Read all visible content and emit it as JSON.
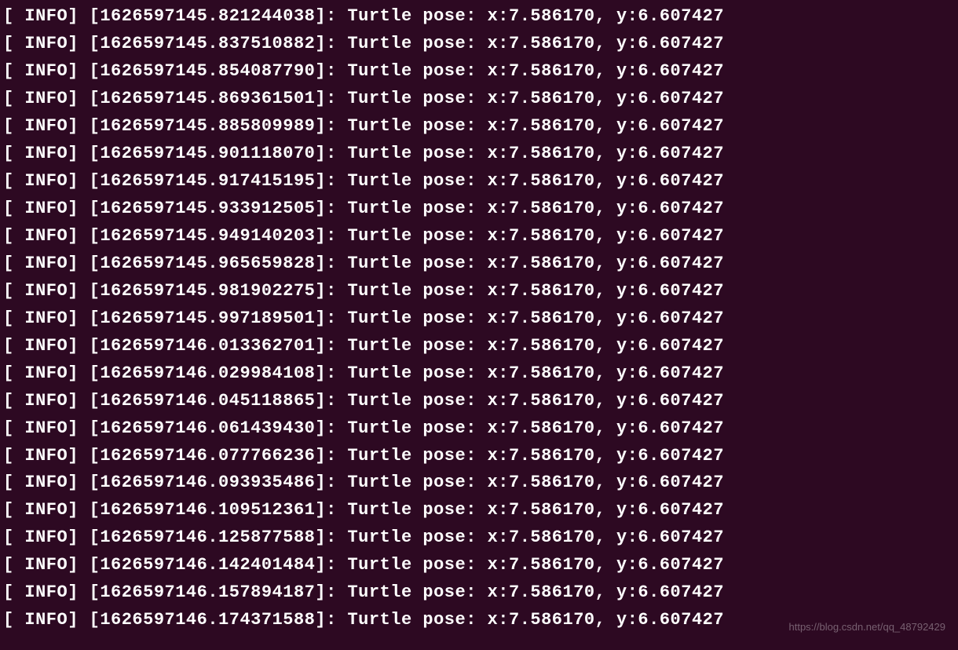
{
  "log": {
    "level": "INFO",
    "message_prefix": "Turtle pose:",
    "x_value": "7.586170",
    "y_value": "6.607427",
    "entries": [
      {
        "timestamp": "1626597145.821244038"
      },
      {
        "timestamp": "1626597145.837510882"
      },
      {
        "timestamp": "1626597145.854087790"
      },
      {
        "timestamp": "1626597145.869361501"
      },
      {
        "timestamp": "1626597145.885809989"
      },
      {
        "timestamp": "1626597145.901118070"
      },
      {
        "timestamp": "1626597145.917415195"
      },
      {
        "timestamp": "1626597145.933912505"
      },
      {
        "timestamp": "1626597145.949140203"
      },
      {
        "timestamp": "1626597145.965659828"
      },
      {
        "timestamp": "1626597145.981902275"
      },
      {
        "timestamp": "1626597145.997189501"
      },
      {
        "timestamp": "1626597146.013362701"
      },
      {
        "timestamp": "1626597146.029984108"
      },
      {
        "timestamp": "1626597146.045118865"
      },
      {
        "timestamp": "1626597146.061439430"
      },
      {
        "timestamp": "1626597146.077766236"
      },
      {
        "timestamp": "1626597146.093935486"
      },
      {
        "timestamp": "1626597146.109512361"
      },
      {
        "timestamp": "1626597146.125877588"
      },
      {
        "timestamp": "1626597146.142401484"
      },
      {
        "timestamp": "1626597146.157894187"
      },
      {
        "timestamp": "1626597146.174371588"
      }
    ]
  },
  "watermark": "https://blog.csdn.net/qq_48792429"
}
